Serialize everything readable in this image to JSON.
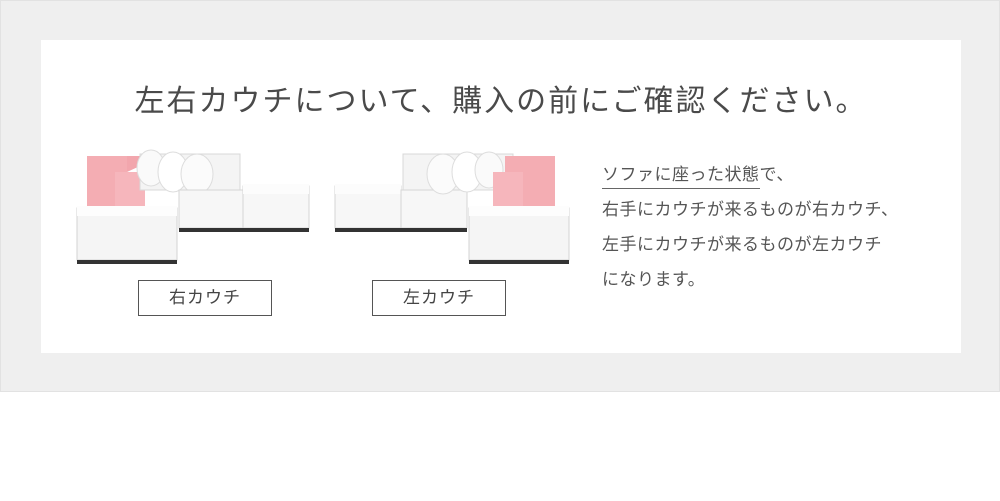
{
  "title": "左右カウチについて、購入の前にご確認ください。",
  "labels": {
    "right": "右カウチ",
    "left": "左カウチ"
  },
  "description": {
    "intro_underlined": "ソファに座った状態",
    "intro_rest": "で、",
    "line2": "右手にカウチが来るものが右カウチ、",
    "line3": "左手にカウチが来るものが左カウチ",
    "line4": "になります。"
  },
  "colors": {
    "accent": "#f2a6ad",
    "sofa": "#f7f7f7",
    "background": "#efefef"
  }
}
